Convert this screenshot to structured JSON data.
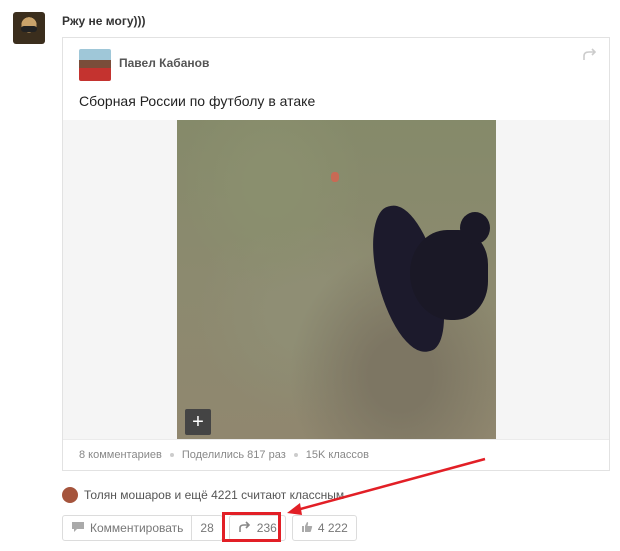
{
  "post": {
    "author": "Ржу не могу)))"
  },
  "shared": {
    "author": "Павел Кабанов",
    "text": "Сборная России по футболу в атаке",
    "stats": {
      "comments": "8 комментариев",
      "shares": "Поделились 817 раз",
      "likes": "15K классов"
    }
  },
  "likers": {
    "text": "Толян мошаров и ещё 4221 считают классным"
  },
  "actions": {
    "comment_label": "Комментировать",
    "comment_count": "28",
    "share_count": "236",
    "like_count": "4 222"
  },
  "colors": {
    "highlight": "#e21f26"
  }
}
